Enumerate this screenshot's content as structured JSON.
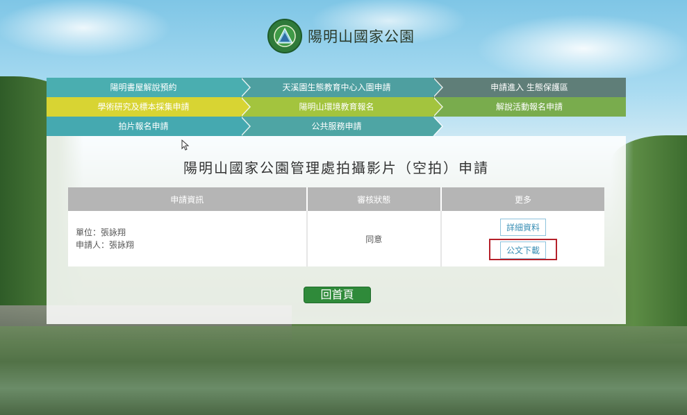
{
  "logo": {
    "text": "陽明山國家公園"
  },
  "menu": {
    "row1": [
      "陽明書屋解說預約",
      "天溪園生態教育中心入園申請",
      "申請進入 生態保護區"
    ],
    "row2": [
      "學術研究及標本採集申請",
      "陽明山環境教育報名",
      "解說活動報名申請"
    ],
    "row3": [
      "拍片報名申請",
      "公共服務申請"
    ]
  },
  "page": {
    "title": "陽明山國家公園管理處拍攝影片（空拍）申請"
  },
  "table": {
    "headers": [
      "申請資訊",
      "審核狀態",
      "更多"
    ],
    "row": {
      "unit": "單位：張詠翔",
      "applicant": "申請人：張詠翔",
      "status": "同意",
      "detail_button": "詳細資料",
      "download_button": "公文下載"
    }
  },
  "home_button": "回首頁",
  "colors": {
    "highlight": "#b5202a",
    "home_button": "#2f8a3a",
    "table_header": "#b5b5b5"
  }
}
